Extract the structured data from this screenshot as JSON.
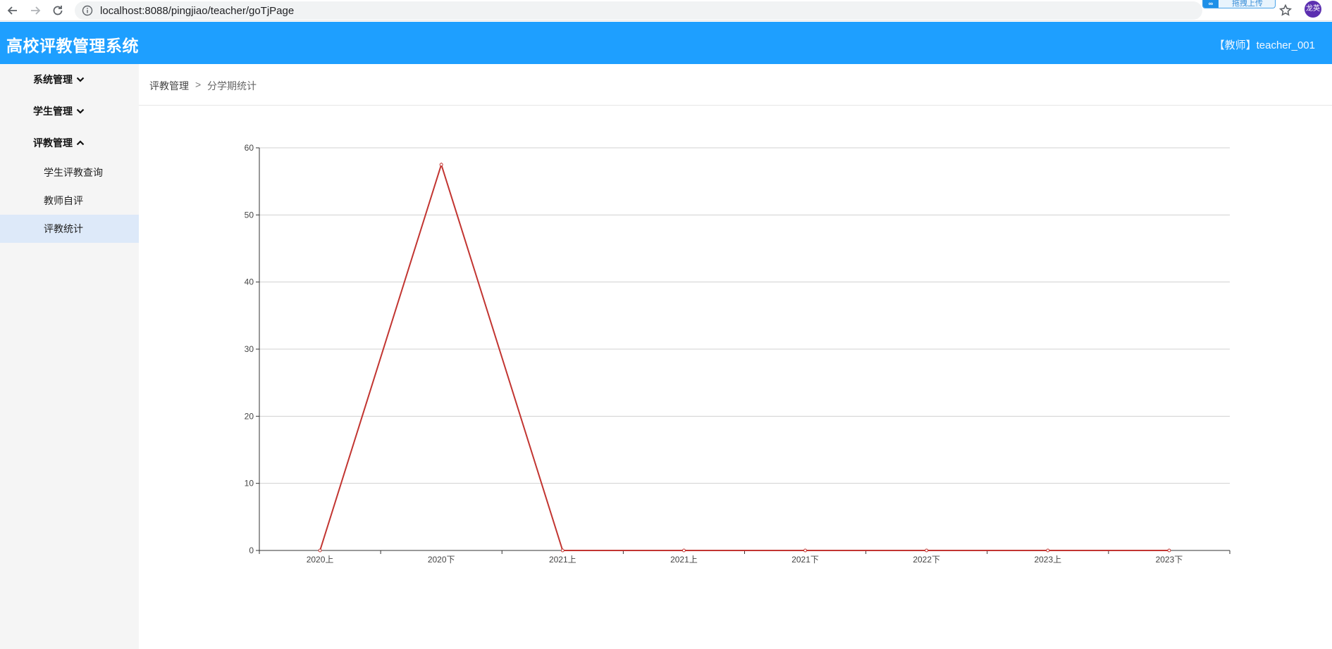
{
  "browser": {
    "url": "localhost:8088/pingjiao/teacher/goTjPage",
    "extension_label": "拖拽上传",
    "profile_initials": "龙英"
  },
  "header": {
    "title": "高校评教管理系统",
    "user": "【教师】teacher_001",
    "bg_color": "#1e9fff"
  },
  "sidebar": {
    "groups": [
      {
        "label": "系统管理",
        "expanded": false
      },
      {
        "label": "学生管理",
        "expanded": false
      },
      {
        "label": "评教管理",
        "expanded": true
      }
    ],
    "subitems": [
      {
        "label": "学生评教查询",
        "active": false
      },
      {
        "label": "教师自评",
        "active": false
      },
      {
        "label": "评教统计",
        "active": true
      }
    ]
  },
  "breadcrumb": {
    "parent": "评教管理",
    "separator": ">",
    "current": "分学期统计"
  },
  "chart_data": {
    "type": "line",
    "categories": [
      "2020上",
      "2020下",
      "2021上",
      "2021上",
      "2021下",
      "2022下",
      "2023上",
      "2023下"
    ],
    "values": [
      0,
      57.5,
      0,
      0,
      0,
      0,
      0,
      0
    ],
    "ylim": [
      0,
      60
    ],
    "yticks": [
      0,
      10,
      20,
      30,
      40,
      50,
      60
    ],
    "grid": true,
    "line_color": "#c23531"
  }
}
